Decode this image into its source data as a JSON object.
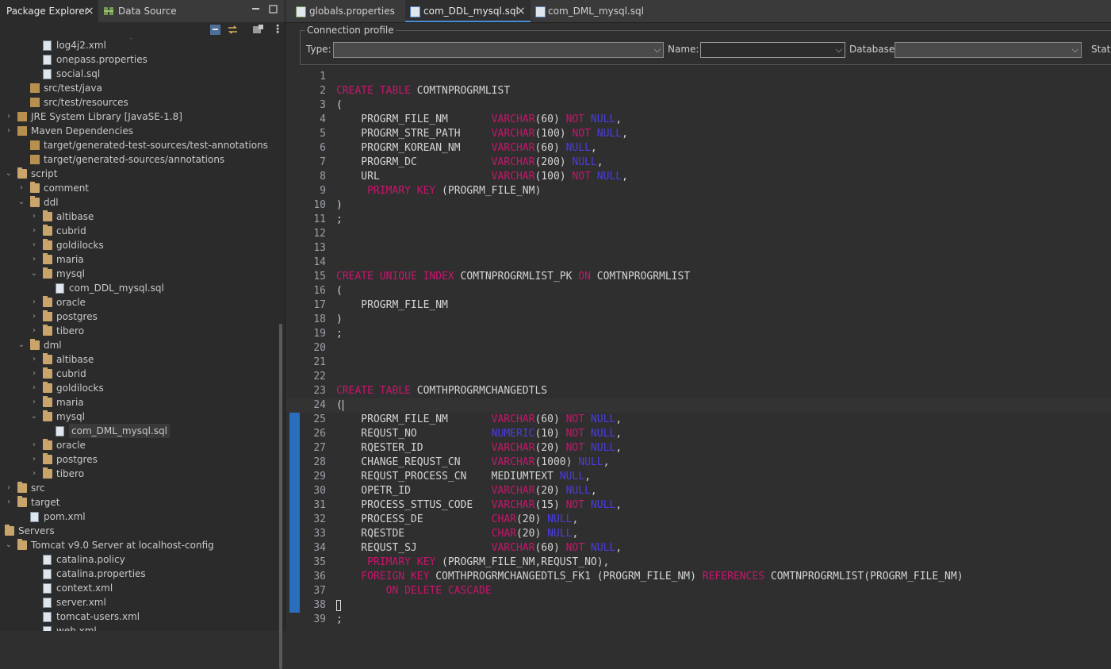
{
  "left_panel": {
    "tabs": [
      {
        "label": "Package Explorer",
        "close": "×"
      },
      {
        "label": "Data Source Explorer"
      }
    ],
    "tree": [
      {
        "label": "log4j2.xml",
        "indent": 2,
        "icon": "xml-file",
        "twisty": ""
      },
      {
        "label": "onepass.properties",
        "indent": 2,
        "icon": "properties-file",
        "twisty": ""
      },
      {
        "label": "social.sql",
        "indent": 2,
        "icon": "sql-file",
        "twisty": ""
      },
      {
        "label": "src/test/java",
        "indent": 1,
        "icon": "source-folder",
        "twisty": ""
      },
      {
        "label": "src/test/resources",
        "indent": 1,
        "icon": "source-folder",
        "twisty": ""
      },
      {
        "label": "JRE System Library [JavaSE-1.8]",
        "indent": 0,
        "icon": "library",
        "twisty": ">"
      },
      {
        "label": "Maven Dependencies",
        "indent": 0,
        "icon": "library",
        "twisty": ">"
      },
      {
        "label": "target/generated-test-sources/test-annotations",
        "indent": 1,
        "icon": "source-folder",
        "twisty": ""
      },
      {
        "label": "target/generated-sources/annotations",
        "indent": 1,
        "icon": "source-folder",
        "twisty": ""
      },
      {
        "label": "script",
        "indent": 0,
        "icon": "folder",
        "twisty": "v"
      },
      {
        "label": "comment",
        "indent": 1,
        "icon": "folder",
        "twisty": ">"
      },
      {
        "label": "ddl",
        "indent": 1,
        "icon": "folder",
        "twisty": "v"
      },
      {
        "label": "altibase",
        "indent": 2,
        "icon": "folder",
        "twisty": ">"
      },
      {
        "label": "cubrid",
        "indent": 2,
        "icon": "folder",
        "twisty": ">"
      },
      {
        "label": "goldilocks",
        "indent": 2,
        "icon": "folder",
        "twisty": ">"
      },
      {
        "label": "maria",
        "indent": 2,
        "icon": "folder",
        "twisty": ">"
      },
      {
        "label": "mysql",
        "indent": 2,
        "icon": "folder",
        "twisty": "v"
      },
      {
        "label": "com_DDL_mysql.sql",
        "indent": 3,
        "icon": "sql-file",
        "twisty": ""
      },
      {
        "label": "oracle",
        "indent": 2,
        "icon": "folder",
        "twisty": ">"
      },
      {
        "label": "postgres",
        "indent": 2,
        "icon": "folder",
        "twisty": ">"
      },
      {
        "label": "tibero",
        "indent": 2,
        "icon": "folder",
        "twisty": ">"
      },
      {
        "label": "dml",
        "indent": 1,
        "icon": "folder",
        "twisty": "v"
      },
      {
        "label": "altibase",
        "indent": 2,
        "icon": "folder",
        "twisty": ">"
      },
      {
        "label": "cubrid",
        "indent": 2,
        "icon": "folder",
        "twisty": ">"
      },
      {
        "label": "goldilocks",
        "indent": 2,
        "icon": "folder",
        "twisty": ">"
      },
      {
        "label": "maria",
        "indent": 2,
        "icon": "folder",
        "twisty": ">"
      },
      {
        "label": "mysql",
        "indent": 2,
        "icon": "folder",
        "twisty": "v"
      },
      {
        "label": "com_DML_mysql.sql",
        "indent": 3,
        "icon": "sql-file",
        "twisty": "",
        "selected": true
      },
      {
        "label": "oracle",
        "indent": 2,
        "icon": "folder",
        "twisty": ">"
      },
      {
        "label": "postgres",
        "indent": 2,
        "icon": "folder",
        "twisty": ">"
      },
      {
        "label": "tibero",
        "indent": 2,
        "icon": "folder",
        "twisty": ">"
      },
      {
        "label": "src",
        "indent": 0,
        "icon": "folder",
        "twisty": ">"
      },
      {
        "label": "target",
        "indent": 0,
        "icon": "folder",
        "twisty": ">"
      },
      {
        "label": "pom.xml",
        "indent": 1,
        "icon": "maven-file",
        "twisty": ""
      },
      {
        "label": "Servers",
        "indent": -1,
        "icon": "folder",
        "twisty": "v"
      },
      {
        "label": "Tomcat v9.0 Server at localhost-config",
        "indent": 0,
        "icon": "folder",
        "twisty": "v"
      },
      {
        "label": "catalina.policy",
        "indent": 2,
        "icon": "file",
        "twisty": ""
      },
      {
        "label": "catalina.properties",
        "indent": 2,
        "icon": "properties-file",
        "twisty": ""
      },
      {
        "label": "context.xml",
        "indent": 2,
        "icon": "xml-file",
        "twisty": ""
      },
      {
        "label": "server.xml",
        "indent": 2,
        "icon": "xml-file",
        "twisty": ""
      },
      {
        "label": "tomcat-users.xml",
        "indent": 2,
        "icon": "xml-file",
        "twisty": ""
      },
      {
        "label": "web.xml",
        "indent": 2,
        "icon": "xml-file",
        "twisty": ""
      }
    ]
  },
  "editor_tabs": [
    {
      "label": "globals.properties",
      "icon": "properties-file"
    },
    {
      "label": "com_DDL_mysql.sql",
      "icon": "sql-file",
      "active": true,
      "close": "×"
    },
    {
      "label": "com_DML_mysql.sql",
      "icon": "sql-file"
    }
  ],
  "connection_profile": {
    "legend": "Connection profile",
    "type_label": "Type:",
    "type_value": "",
    "name_label": "Name:",
    "name_value": "",
    "database_label": "Database:",
    "database_value": "",
    "status_label": "Statu"
  },
  "code_lines": [
    {
      "n": "1",
      "tokens": []
    },
    {
      "n": "2",
      "tokens": [
        [
          "k",
          "CREATE TABLE "
        ],
        [
          "t",
          "COMTNPROGRMLIST"
        ]
      ]
    },
    {
      "n": "3",
      "tokens": [
        [
          "t",
          "("
        ]
      ]
    },
    {
      "n": "4",
      "tokens": [
        [
          "t",
          "    PROGRM_FILE_NM       "
        ],
        [
          "k",
          "VARCHAR"
        ],
        [
          "t",
          "(60) "
        ],
        [
          "k",
          "NOT "
        ],
        [
          "n",
          "NULL"
        ],
        [
          "t",
          ","
        ]
      ]
    },
    {
      "n": "5",
      "tokens": [
        [
          "t",
          "    PROGRM_STRE_PATH     "
        ],
        [
          "k",
          "VARCHAR"
        ],
        [
          "t",
          "(100) "
        ],
        [
          "k",
          "NOT "
        ],
        [
          "n",
          "NULL"
        ],
        [
          "t",
          ","
        ]
      ]
    },
    {
      "n": "6",
      "tokens": [
        [
          "t",
          "    PROGRM_KOREAN_NM     "
        ],
        [
          "k",
          "VARCHAR"
        ],
        [
          "t",
          "(60) "
        ],
        [
          "n",
          "NULL"
        ],
        [
          "t",
          ","
        ]
      ]
    },
    {
      "n": "7",
      "tokens": [
        [
          "t",
          "    PROGRM_DC            "
        ],
        [
          "k",
          "VARCHAR"
        ],
        [
          "t",
          "(200) "
        ],
        [
          "n",
          "NULL"
        ],
        [
          "t",
          ","
        ]
      ]
    },
    {
      "n": "8",
      "tokens": [
        [
          "t",
          "    URL                  "
        ],
        [
          "k",
          "VARCHAR"
        ],
        [
          "t",
          "(100) "
        ],
        [
          "k",
          "NOT "
        ],
        [
          "n",
          "NULL"
        ],
        [
          "t",
          ","
        ]
      ]
    },
    {
      "n": "9",
      "tokens": [
        [
          "t",
          "     "
        ],
        [
          "k",
          "PRIMARY KEY"
        ],
        [
          "t",
          " (PROGRM_FILE_NM)"
        ]
      ]
    },
    {
      "n": "10",
      "tokens": [
        [
          "t",
          ")"
        ]
      ]
    },
    {
      "n": "11",
      "tokens": [
        [
          "t",
          ";"
        ]
      ]
    },
    {
      "n": "12",
      "tokens": []
    },
    {
      "n": "13",
      "tokens": []
    },
    {
      "n": "14",
      "tokens": []
    },
    {
      "n": "15",
      "tokens": [
        [
          "k",
          "CREATE UNIQUE INDEX "
        ],
        [
          "t",
          "COMTNPROGRMLIST_PK "
        ],
        [
          "k",
          "ON "
        ],
        [
          "t",
          "COMTNPROGRMLIST"
        ]
      ]
    },
    {
      "n": "16",
      "tokens": [
        [
          "t",
          "("
        ]
      ]
    },
    {
      "n": "17",
      "tokens": [
        [
          "t",
          "    PROGRM_FILE_NM"
        ]
      ]
    },
    {
      "n": "18",
      "tokens": [
        [
          "t",
          ")"
        ]
      ]
    },
    {
      "n": "19",
      "tokens": [
        [
          "t",
          ";"
        ]
      ]
    },
    {
      "n": "20",
      "tokens": []
    },
    {
      "n": "21",
      "tokens": []
    },
    {
      "n": "22",
      "tokens": []
    },
    {
      "n": "23",
      "tokens": [
        [
          "k",
          "CREATE TABLE "
        ],
        [
          "t",
          "COMTHPROGRMCHANGEDTLS"
        ]
      ]
    },
    {
      "n": "24",
      "tokens": [
        [
          "t",
          "("
        ],
        [
          "c",
          ""
        ]
      ],
      "current": true
    },
    {
      "n": "25",
      "tokens": [
        [
          "t",
          "    PROGRM_FILE_NM       "
        ],
        [
          "k",
          "VARCHAR"
        ],
        [
          "t",
          "(60) "
        ],
        [
          "k",
          "NOT "
        ],
        [
          "n",
          "NULL"
        ],
        [
          "t",
          ","
        ]
      ]
    },
    {
      "n": "26",
      "tokens": [
        [
          "t",
          "    REQUST_NO            "
        ],
        [
          "n",
          "NUMERIC"
        ],
        [
          "t",
          "(10) "
        ],
        [
          "k",
          "NOT "
        ],
        [
          "n",
          "NULL"
        ],
        [
          "t",
          ","
        ]
      ]
    },
    {
      "n": "27",
      "tokens": [
        [
          "t",
          "    RQESTER_ID           "
        ],
        [
          "k",
          "VARCHAR"
        ],
        [
          "t",
          "(20) "
        ],
        [
          "k",
          "NOT "
        ],
        [
          "n",
          "NULL"
        ],
        [
          "t",
          ","
        ]
      ]
    },
    {
      "n": "28",
      "tokens": [
        [
          "t",
          "    CHANGE_REQUST_CN     "
        ],
        [
          "k",
          "VARCHAR"
        ],
        [
          "t",
          "(1000) "
        ],
        [
          "n",
          "NULL"
        ],
        [
          "t",
          ","
        ]
      ]
    },
    {
      "n": "29",
      "tokens": [
        [
          "t",
          "    REQUST_PROCESS_CN    MEDIUMTEXT "
        ],
        [
          "n",
          "NULL"
        ],
        [
          "t",
          ","
        ]
      ]
    },
    {
      "n": "30",
      "tokens": [
        [
          "t",
          "    OPETR_ID             "
        ],
        [
          "k",
          "VARCHAR"
        ],
        [
          "t",
          "(20) "
        ],
        [
          "n",
          "NULL"
        ],
        [
          "t",
          ","
        ]
      ]
    },
    {
      "n": "31",
      "tokens": [
        [
          "t",
          "    PROCESS_STTUS_CODE   "
        ],
        [
          "k",
          "VARCHAR"
        ],
        [
          "t",
          "(15) "
        ],
        [
          "k",
          "NOT "
        ],
        [
          "n",
          "NULL"
        ],
        [
          "t",
          ","
        ]
      ]
    },
    {
      "n": "32",
      "tokens": [
        [
          "t",
          "    PROCESS_DE           "
        ],
        [
          "k",
          "CHAR"
        ],
        [
          "t",
          "(20) "
        ],
        [
          "n",
          "NULL"
        ],
        [
          "t",
          ","
        ]
      ]
    },
    {
      "n": "33",
      "tokens": [
        [
          "t",
          "    RQESTDE              "
        ],
        [
          "k",
          "CHAR"
        ],
        [
          "t",
          "(20) "
        ],
        [
          "n",
          "NULL"
        ],
        [
          "t",
          ","
        ]
      ]
    },
    {
      "n": "34",
      "tokens": [
        [
          "t",
          "    REQUST_SJ            "
        ],
        [
          "k",
          "VARCHAR"
        ],
        [
          "t",
          "(60) "
        ],
        [
          "k",
          "NOT "
        ],
        [
          "n",
          "NULL"
        ],
        [
          "t",
          ","
        ]
      ]
    },
    {
      "n": "35",
      "tokens": [
        [
          "t",
          "     "
        ],
        [
          "k",
          "PRIMARY KEY"
        ],
        [
          "t",
          " (PROGRM_FILE_NM,REQUST_NO),"
        ]
      ]
    },
    {
      "n": "36",
      "tokens": [
        [
          "t",
          "    "
        ],
        [
          "k",
          "FOREIGN KEY"
        ],
        [
          "t",
          " COMTHPROGRMCHANGEDTLS_FK1 (PROGRM_FILE_NM) "
        ],
        [
          "k",
          "REFERENCES"
        ],
        [
          "t",
          " COMTNPROGRMLIST(PROGRM_FILE_NM)"
        ]
      ]
    },
    {
      "n": "37",
      "tokens": [
        [
          "t",
          "        "
        ],
        [
          "k",
          "ON DELETE CASCADE"
        ]
      ]
    },
    {
      "n": "38",
      "tokens": [
        [
          "b",
          ""
        ]
      ]
    },
    {
      "n": "39",
      "tokens": [
        [
          "t",
          ";"
        ]
      ]
    }
  ]
}
